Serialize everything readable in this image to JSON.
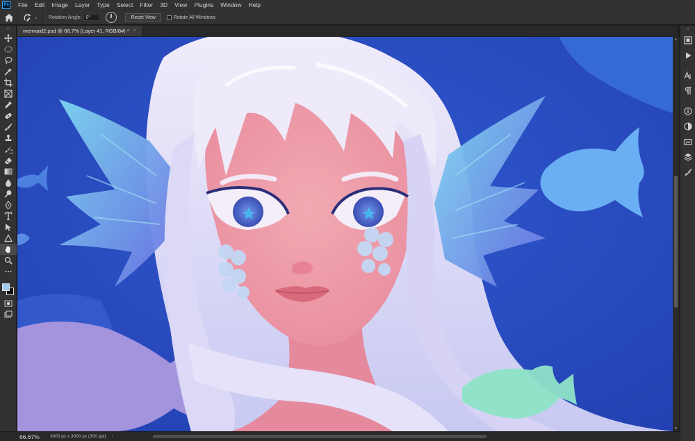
{
  "app": {
    "logo_text": "Ps"
  },
  "menu": [
    "File",
    "Edit",
    "Image",
    "Layer",
    "Type",
    "Select",
    "Filter",
    "3D",
    "View",
    "Plugins",
    "Window",
    "Help"
  ],
  "options": {
    "rotation_label": "Rotation Angle:",
    "rotation_value": "0°",
    "reset_view": "Reset View",
    "rotate_all_windows": "Rotate All Windows"
  },
  "document": {
    "tab_title": "mermaid2.psd @ 66.7% (Layer 41, RGB/8#) *",
    "close": "×"
  },
  "status": {
    "zoom": "66.67%",
    "info": "3000 px x 3000 px (300 ppi)",
    "arrow": "›"
  },
  "colors": {
    "foreground": "#9fcbf0",
    "background": "#111111",
    "canvas_bg": "#2c4cc4"
  },
  "tools": [
    "move-icon",
    "marquee-icon",
    "lasso-icon",
    "quick-select-icon",
    "crop-icon",
    "frame-icon",
    "eyedropper-icon",
    "healing-brush-icon",
    "brush-icon",
    "clone-stamp-icon",
    "history-brush-icon",
    "eraser-icon",
    "gradient-icon",
    "blur-icon",
    "dodge-icon",
    "pen-icon",
    "type-icon",
    "path-select-icon",
    "shape-icon",
    "hand-icon",
    "zoom-icon"
  ],
  "right_panels": [
    "color-panel",
    "actions-panel",
    "character-panel",
    "paragraph-panel",
    "properties-panel",
    "adjustments-panel",
    "libraries-panel",
    "layers-panel",
    "brushes-panel"
  ]
}
